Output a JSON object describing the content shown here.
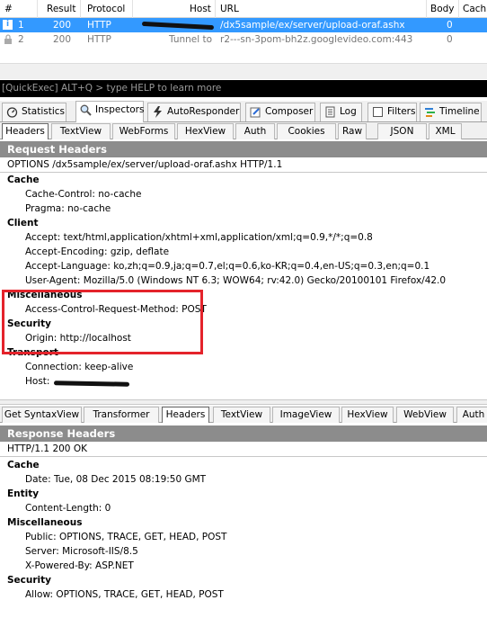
{
  "sessions": {
    "columns": [
      "#",
      "Result",
      "Protocol",
      "Host",
      "URL",
      "Body",
      "Cachi"
    ],
    "rows": [
      {
        "id": "1",
        "result": "200",
        "protocol": "HTTP",
        "host": "",
        "url": "/dx5sample/ex/server/upload-oraf.ashx",
        "body": "0",
        "icon": "info-icon"
      },
      {
        "id": "2",
        "result": "200",
        "protocol": "HTTP",
        "host": "Tunnel to",
        "url": "r2---sn-3pom-bh2z.googlevideo.com:443",
        "body": "0",
        "icon": "lock-icon"
      }
    ]
  },
  "quickexec": {
    "text": "[QuickExec] ALT+Q > type HELP to learn more"
  },
  "main_tabs": [
    {
      "label": "Statistics",
      "icon": "stopwatch-icon"
    },
    {
      "label": "Inspectors",
      "icon": "magnifier-icon"
    },
    {
      "label": "AutoResponder",
      "icon": "lightning-icon"
    },
    {
      "label": "Composer",
      "icon": "pencil-icon"
    },
    {
      "label": "Log",
      "icon": "log-icon"
    },
    {
      "label": "Filters",
      "icon": "checkbox-icon"
    },
    {
      "label": "Timeline",
      "icon": "timeline-icon"
    }
  ],
  "request_tabs": [
    "Headers",
    "TextView",
    "WebForms",
    "HexView",
    "Auth",
    "Cookies",
    "Raw",
    "JSON",
    "XML"
  ],
  "request": {
    "title": "Request Headers",
    "line": "OPTIONS /dx5sample/ex/server/upload-oraf.ashx HTTP/1.1",
    "groups": [
      {
        "name": "Cache",
        "items": [
          "Cache-Control: no-cache",
          "Pragma: no-cache"
        ]
      },
      {
        "name": "Client",
        "items": [
          "Accept: text/html,application/xhtml+xml,application/xml;q=0.9,*/*;q=0.8",
          "Accept-Encoding: gzip, deflate",
          "Accept-Language: ko,zh;q=0.9,ja;q=0.7,el;q=0.6,ko-KR;q=0.4,en-US;q=0.3,en;q=0.1",
          "User-Agent: Mozilla/5.0 (Windows NT 6.3; WOW64; rv:42.0) Gecko/20100101 Firefox/42.0"
        ]
      },
      {
        "name": "Miscellaneous",
        "items": [
          "Access-Control-Request-Method: POST"
        ]
      },
      {
        "name": "Security",
        "items": [
          "Origin: http://localhost"
        ]
      },
      {
        "name": "Transport",
        "items": [
          "Connection: keep-alive",
          "Host: "
        ]
      }
    ]
  },
  "response_tabs": [
    "Get SyntaxView",
    "Transformer",
    "Headers",
    "TextView",
    "ImageView",
    "HexView",
    "WebView",
    "Auth"
  ],
  "response": {
    "title": "Response Headers",
    "line": "HTTP/1.1 200 OK",
    "groups": [
      {
        "name": "Cache",
        "items": [
          "Date: Tue, 08 Dec 2015 08:19:50 GMT"
        ]
      },
      {
        "name": "Entity",
        "items": [
          "Content-Length: 0"
        ]
      },
      {
        "name": "Miscellaneous",
        "items": [
          "Public: OPTIONS, TRACE, GET, HEAD, POST",
          "Server: Microsoft-IIS/8.5",
          "X-Powered-By: ASP.NET"
        ]
      },
      {
        "name": "Security",
        "items": [
          "Allow: OPTIONS, TRACE, GET, HEAD, POST"
        ]
      }
    ]
  },
  "colors": {
    "selection": "#3399ff",
    "panel_title": "#8c8c8c",
    "highlight_box": "#e4232b"
  }
}
